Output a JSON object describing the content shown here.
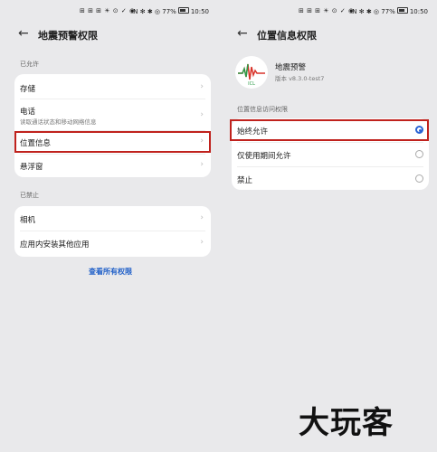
{
  "left": {
    "status": {
      "icons": "⊞ ⊞ ⊞ ☀ ⊙ ✓ ◉",
      "right_icons": "N ✻ ✱ ◎",
      "battery": "77%",
      "time": "10:50"
    },
    "title": "地震预警权限",
    "allowed_label": "已允许",
    "allowed_items": [
      {
        "label": "存储"
      },
      {
        "label": "电话",
        "sub": "读取通话状态和移动网络信息"
      },
      {
        "label": "位置信息"
      },
      {
        "label": "悬浮窗"
      }
    ],
    "denied_label": "已禁止",
    "denied_items": [
      {
        "label": "相机"
      },
      {
        "label": "应用内安装其他应用"
      }
    ],
    "view_all": "查看所有权限"
  },
  "right": {
    "status": {
      "icons": "⊞ ⊞ ⊞ ☀ ⊙ ✓ ◉",
      "right_icons": "N ✻ ✱ ◎",
      "battery": "77%",
      "time": "10:50"
    },
    "title": "位置信息权限",
    "app": {
      "name": "地震预警",
      "version": "版本 v8.3.0-test7",
      "logo_text": "ICL"
    },
    "access_label": "位置信息访问权限",
    "options": [
      {
        "label": "始终允许",
        "selected": true
      },
      {
        "label": "仅使用期间允许",
        "selected": false
      },
      {
        "label": "禁止",
        "selected": false
      }
    ]
  },
  "watermark": "大玩客",
  "colors": {
    "highlight": "#c0221d",
    "accent": "#2a63d4",
    "link": "#1f5fc8"
  }
}
